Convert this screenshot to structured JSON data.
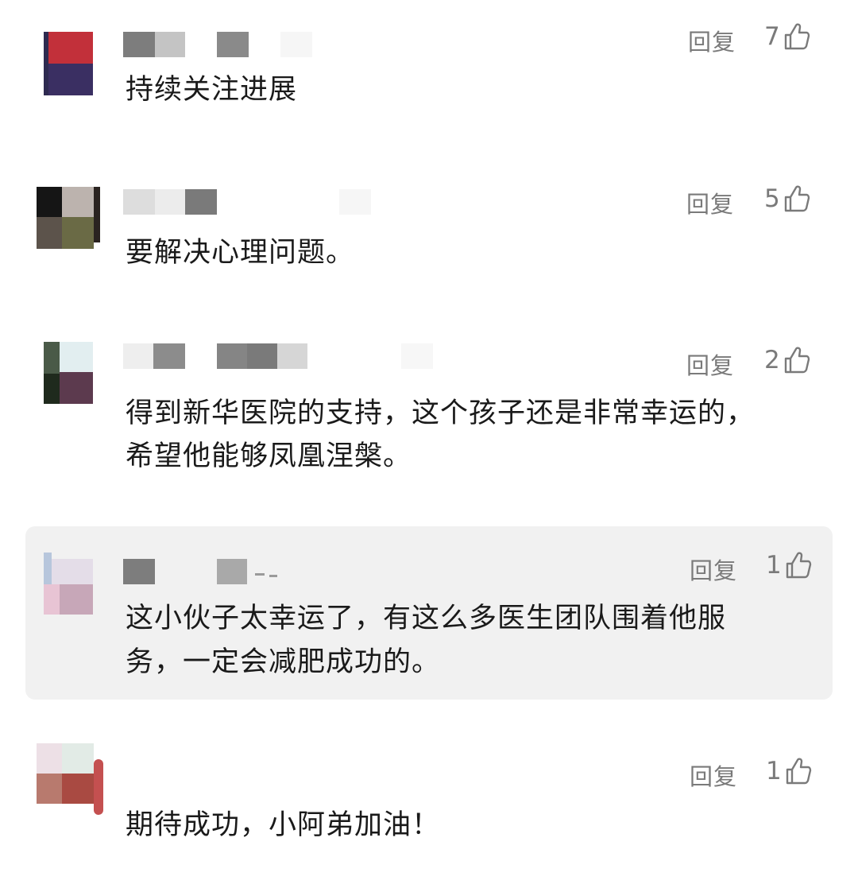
{
  "comments": [
    {
      "text": "持续关注进展",
      "reply_label": "回复",
      "likes": "7"
    },
    {
      "text": "要解决心理问题。",
      "reply_label": "回复",
      "likes": "5"
    },
    {
      "text_line1": "得到新华医院的支持，这个孩子还是非常幸运的，",
      "text_line2": "希望他能够凤凰涅槃。",
      "reply_label": "回复",
      "likes": "2"
    },
    {
      "text_line1": "这小伙子太幸运了，有这么多医生团队围着他服",
      "text_line2": "务，一定会减肥成功的。",
      "reply_label": "回复",
      "likes": "1",
      "highlighted": true
    },
    {
      "text": "期待成功，小阿弟加油！",
      "reply_label": "回复",
      "likes": "1"
    }
  ],
  "colors": {
    "text": "#1a1a1a",
    "meta": "#7a7a7a",
    "highlight_bg": "#f1f1f1"
  },
  "icons": {
    "like": "thumbs-up-icon"
  }
}
